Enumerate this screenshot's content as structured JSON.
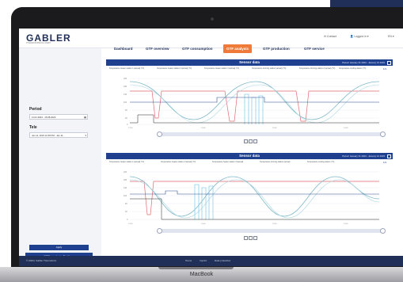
{
  "app": {
    "logo": "GABLER",
    "logo_sub": "THERMOFORMING GMBH",
    "top_links": [
      "Contact",
      "Logged in",
      "EN"
    ]
  },
  "device": {
    "label": "MacBook"
  },
  "nav": {
    "tabs": [
      {
        "label": "Dashboard",
        "active": false
      },
      {
        "label": "GTF overview",
        "active": false
      },
      {
        "label": "GTF consumption",
        "active": false
      },
      {
        "label": "GTF analysis",
        "active": true
      },
      {
        "label": "GTF production",
        "active": false
      },
      {
        "label": "GTF service",
        "active": false
      }
    ]
  },
  "sidebar": {
    "period_label": "Period",
    "period_value": "11.01.2023 - 15.08.2023",
    "tele_label": "Tele",
    "tele_value": "Jan 11, 2023 12:39 PM - Jan 11...",
    "apply_label": "Apply",
    "settings_label": "GTF analysis Settings"
  },
  "panels": [
    {
      "title": "Sensor data",
      "period": "Period: January 31 2023 - January 31 2023",
      "legend": [
        "Temperature heater station 1 (actual) (°C)",
        "Temperature heater station 2 (actual) (°C)",
        "Temperature heater station 3 (actual) (°C)",
        "Temperature forming station (actual) (°C)",
        "Temperature forming station 2 (actual) (°C)",
        "Temperature cooling station (°C)"
      ],
      "legend_more": "1/3"
    },
    {
      "title": "Sensor data",
      "period": "Period: January 31 2023 - January 31 2023",
      "legend": [
        "Temperature heater station 1 (actual) (°C)",
        "Temperature heater station 2 (actual) (°C)",
        "Temperature heater station 3 (actual)",
        "Temperature forming station (actual)",
        "Temperature cooling station (°C)"
      ],
      "legend_more": "1/3"
    }
  ],
  "footer": {
    "copyright": "© 2023 | Gabler Thermoform",
    "links": [
      "Terms",
      "Imprint",
      "Data protection"
    ]
  },
  "colors": {
    "navy": "#1f2f57",
    "panel_head": "#1f3f8f",
    "active_tab": "#f07a3a",
    "series_teal": "#7fb8c6",
    "series_red": "#e06a72",
    "series_lightblue": "#8fd0ea",
    "series_darkblue": "#2f4f8f",
    "series_black": "#222222"
  }
}
